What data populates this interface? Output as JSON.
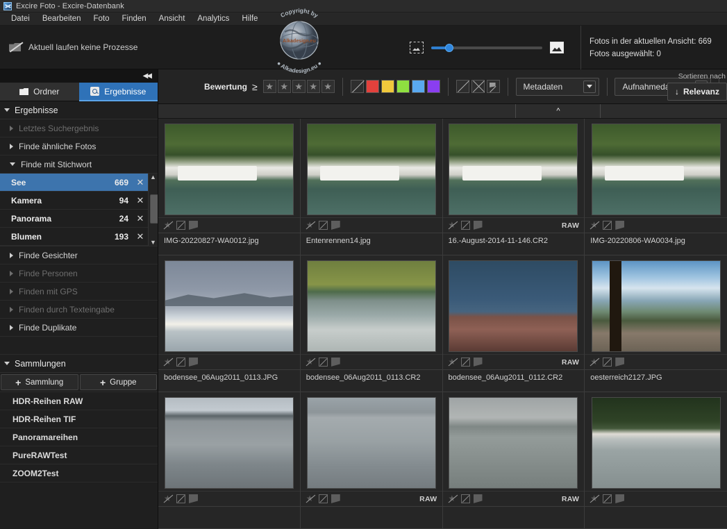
{
  "window": {
    "title": "Excire Foto - Excire-Datenbank",
    "app_icon": "excire-logo-icon"
  },
  "menu": {
    "items": [
      "Datei",
      "Bearbeiten",
      "Foto",
      "Finden",
      "Ansicht",
      "Analytics",
      "Hilfe"
    ]
  },
  "topbar": {
    "process_status": "Aktuell laufen keine Prozesse",
    "process_icon": "no-process-icon",
    "zoom_small_icon": "thumbnail-small-icon",
    "zoom_large_icon": "thumbnail-large-icon",
    "count_in_view": "Fotos in der aktuellen Ansicht: 669",
    "count_selected": "Fotos ausgewählt: 0"
  },
  "watermark": {
    "line1": "Copyright by",
    "line2": "Alkadesign.eu"
  },
  "sidebar": {
    "collapse_glyph": "◀◀",
    "tabs": [
      {
        "label": "Ordner",
        "icon": "folder-icon",
        "active": false
      },
      {
        "label": "Ergebnisse",
        "icon": "search-icon",
        "active": true
      }
    ],
    "results_header": "Ergebnisse",
    "groups": [
      {
        "label": "Letztes Suchergebnis",
        "open": false,
        "dim": true
      },
      {
        "label": "Finde ähnliche Fotos",
        "open": false,
        "dim": false
      },
      {
        "label": "Finde mit Stichwort",
        "open": true,
        "dim": false
      }
    ],
    "keywords": [
      {
        "name": "See",
        "count": "669",
        "selected": true
      },
      {
        "name": "Kamera",
        "count": "94",
        "selected": false
      },
      {
        "name": "Panorama",
        "count": "24",
        "selected": false
      },
      {
        "name": "Blumen",
        "count": "193",
        "selected": false
      }
    ],
    "keyword_remove_glyph": "✕",
    "groups2": [
      {
        "label": "Finde Gesichter",
        "dim": false
      },
      {
        "label": "Finde Personen",
        "dim": true
      },
      {
        "label": "Finden mit GPS",
        "dim": true
      },
      {
        "label": "Finden durch Texteingabe",
        "dim": true
      },
      {
        "label": "Finde Duplikate",
        "dim": false
      }
    ],
    "collections_header": "Sammlungen",
    "add_collection": "Sammlung",
    "add_group": "Gruppe",
    "plus_glyph": "+",
    "collections": [
      "HDR-Reihen RAW",
      "HDR-Reihen TIF",
      "Panoramareihen",
      "PureRAWTest",
      "ZOOM2Test"
    ]
  },
  "filterbar": {
    "rating_label": "Bewertung",
    "rating_operator": "≥",
    "star_glyph": "★",
    "star_count": 5,
    "color_labels": [
      {
        "name": "none",
        "hex": "#2e2e2e"
      },
      {
        "name": "red",
        "hex": "#e2413c"
      },
      {
        "name": "yellow",
        "hex": "#f0c83c"
      },
      {
        "name": "green",
        "hex": "#8fe040"
      },
      {
        "name": "blue",
        "hex": "#5aa9f0"
      },
      {
        "name": "purple",
        "hex": "#8a3ef0"
      }
    ],
    "flag_buttons": [
      "flag-none-icon",
      "flag-rejected-icon",
      "flag-picked-icon"
    ],
    "metadata_select": "Metadaten",
    "date_select": "Aufnahmedatum",
    "sort_caption": "Sortieren nach",
    "sort_value": "Relevanz",
    "sort_arrow": "↓"
  },
  "grid": {
    "caret_glyph": "^",
    "raw_badge": "RAW",
    "cell_icons": [
      "rating-none-icon",
      "color-none-icon",
      "flag-icon"
    ],
    "photos": [
      {
        "filename": "IMG-20220827-WA0012.jpg",
        "raw": "",
        "img": "im1"
      },
      {
        "filename": "Entenrennen14.jpg",
        "raw": "",
        "img": "im1"
      },
      {
        "filename": "16.-August-2014-11-146.CR2",
        "raw": "RAW",
        "img": "im1"
      },
      {
        "filename": "IMG-20220806-WA0034.jpg",
        "raw": "",
        "img": "im1"
      },
      {
        "filename": "bodensee_06Aug2011_0113.JPG",
        "raw": "",
        "img": "im2"
      },
      {
        "filename": "bodensee_06Aug2011_0113.CR2",
        "raw": "",
        "img": "im3"
      },
      {
        "filename": "bodensee_06Aug2011_0112.CR2",
        "raw": "RAW",
        "img": "im4"
      },
      {
        "filename": "oesterreich2127.JPG",
        "raw": "",
        "img": "im5"
      },
      {
        "filename": "",
        "raw": "",
        "img": "im6"
      },
      {
        "filename": "",
        "raw": "RAW",
        "img": "im7"
      },
      {
        "filename": "",
        "raw": "RAW",
        "img": "im8"
      },
      {
        "filename": "",
        "raw": "",
        "img": "im9"
      }
    ]
  }
}
